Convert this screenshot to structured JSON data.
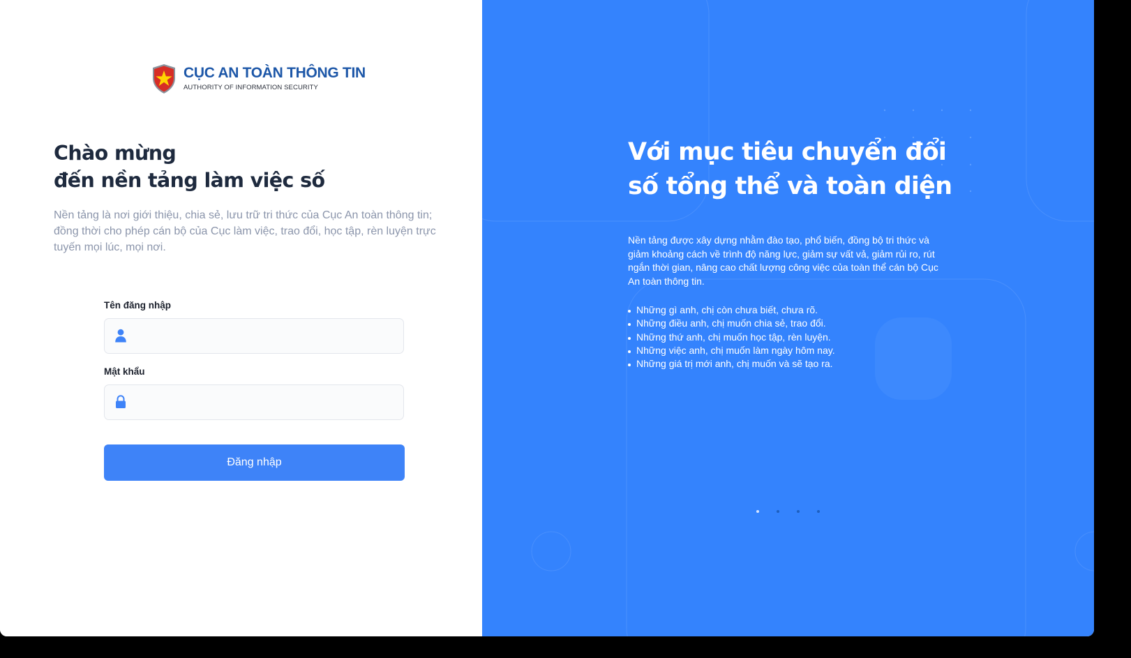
{
  "brand": {
    "title": "CỤC AN TOÀN THÔNG TIN",
    "subtitle": "AUTHORITY OF INFORMATION SECURITY",
    "icon": "shield-star-emblem",
    "colors": {
      "title": "#1d57a8",
      "shield_red": "#d72d26",
      "star": "#ffd400"
    }
  },
  "welcome": {
    "title_line1": "Chào mừng",
    "title_line2": "đến nền tảng làm việc số",
    "description": "Nền tảng là nơi giới thiệu, chia sẻ, lưu trữ tri thức của Cục An toàn thông tin; đồng thời cho phép cán bộ của Cục làm việc, trao đổi, học tập, rèn luyện trực tuyến mọi lúc, mọi nơi."
  },
  "form": {
    "username_label": "Tên đăng nhập",
    "username_value": "",
    "username_icon": "user-icon",
    "password_label": "Mật khẩu",
    "password_value": "",
    "password_icon": "lock-icon",
    "submit_label": "Đăng nhập"
  },
  "hero": {
    "title_line1": "Với mục tiêu chuyển đổi",
    "title_line2": "số tổng thể và toàn diện",
    "description": "Nền tảng được xây dựng nhằm đào tạo, phổ biến, đồng bộ tri thức và giảm khoảng cách về trình độ năng lực, giảm sự vất vả, giảm rủi ro, rút ngắn thời gian, nâng cao chất lượng công việc của toàn thể cán bộ Cục An toàn thông tin.",
    "bullets": [
      "Những gì anh, chị còn chưa biết, chưa rõ.",
      "Những điều anh, chị muốn chia sẻ, trao đổi.",
      "Những thứ anh, chị muốn học tập, rèn luyện.",
      "Những việc anh, chị muốn làm ngày hôm nay.",
      "Những giá trị mới anh, chị muốn và sẽ tạo ra."
    ],
    "carousel": {
      "slide_count": 4,
      "active_slide": 1
    }
  },
  "colors": {
    "accent": "#3e83f8",
    "hero_background": "#3483fd",
    "title_text": "#1e2a3e",
    "muted_text": "#8b95ab"
  }
}
